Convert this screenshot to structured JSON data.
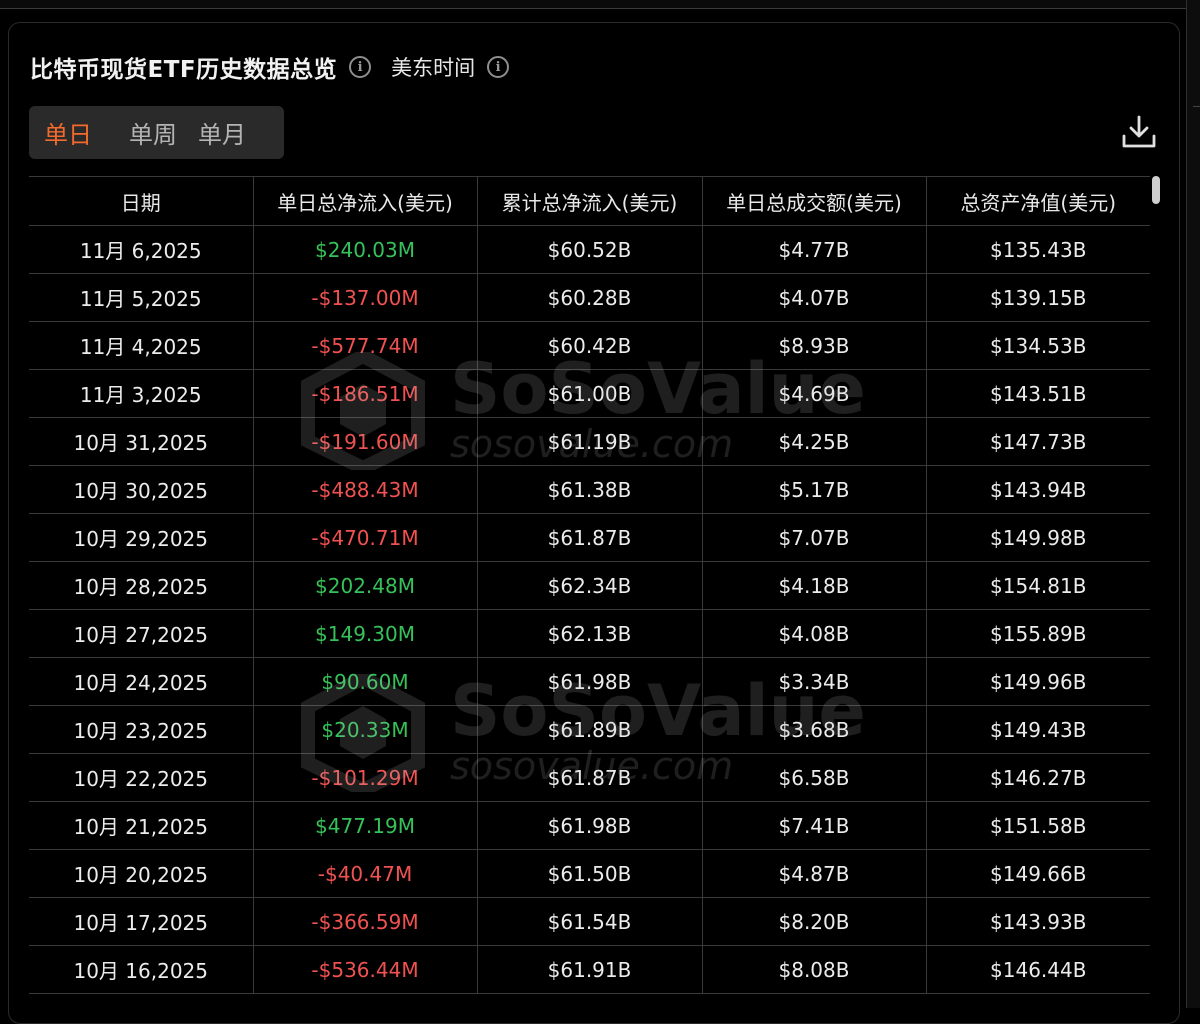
{
  "header": {
    "title": "比特币现货ETF历史数据总览",
    "timezone_label": "美东时间"
  },
  "tabs": [
    {
      "label": "单日",
      "active": true
    },
    {
      "label": "单周",
      "active": false
    },
    {
      "label": "单月",
      "active": false
    }
  ],
  "icons": {
    "title_info": "info-icon",
    "timezone_info": "info-icon",
    "download": "download-icon"
  },
  "colors": {
    "accent": "#f46a2c",
    "positive": "#36c25a",
    "negative": "#f05252"
  },
  "table": {
    "columns": [
      "日期",
      "单日总净流入(美元)",
      "累计总净流入(美元)",
      "单日总成交额(美元)",
      "总资产净值(美元)"
    ],
    "rows": [
      {
        "date": "11月 6,2025",
        "daily_net_inflow": "$240.03M",
        "cum_net_inflow": "$60.52B",
        "daily_volume": "$4.77B",
        "net_assets": "$135.43B",
        "sign": "pos"
      },
      {
        "date": "11月 5,2025",
        "daily_net_inflow": "-$137.00M",
        "cum_net_inflow": "$60.28B",
        "daily_volume": "$4.07B",
        "net_assets": "$139.15B",
        "sign": "neg"
      },
      {
        "date": "11月 4,2025",
        "daily_net_inflow": "-$577.74M",
        "cum_net_inflow": "$60.42B",
        "daily_volume": "$8.93B",
        "net_assets": "$134.53B",
        "sign": "neg"
      },
      {
        "date": "11月 3,2025",
        "daily_net_inflow": "-$186.51M",
        "cum_net_inflow": "$61.00B",
        "daily_volume": "$4.69B",
        "net_assets": "$143.51B",
        "sign": "neg"
      },
      {
        "date": "10月 31,2025",
        "daily_net_inflow": "-$191.60M",
        "cum_net_inflow": "$61.19B",
        "daily_volume": "$4.25B",
        "net_assets": "$147.73B",
        "sign": "neg"
      },
      {
        "date": "10月 30,2025",
        "daily_net_inflow": "-$488.43M",
        "cum_net_inflow": "$61.38B",
        "daily_volume": "$5.17B",
        "net_assets": "$143.94B",
        "sign": "neg"
      },
      {
        "date": "10月 29,2025",
        "daily_net_inflow": "-$470.71M",
        "cum_net_inflow": "$61.87B",
        "daily_volume": "$7.07B",
        "net_assets": "$149.98B",
        "sign": "neg"
      },
      {
        "date": "10月 28,2025",
        "daily_net_inflow": "$202.48M",
        "cum_net_inflow": "$62.34B",
        "daily_volume": "$4.18B",
        "net_assets": "$154.81B",
        "sign": "pos"
      },
      {
        "date": "10月 27,2025",
        "daily_net_inflow": "$149.30M",
        "cum_net_inflow": "$62.13B",
        "daily_volume": "$4.08B",
        "net_assets": "$155.89B",
        "sign": "pos"
      },
      {
        "date": "10月 24,2025",
        "daily_net_inflow": "$90.60M",
        "cum_net_inflow": "$61.98B",
        "daily_volume": "$3.34B",
        "net_assets": "$149.96B",
        "sign": "pos"
      },
      {
        "date": "10月 23,2025",
        "daily_net_inflow": "$20.33M",
        "cum_net_inflow": "$61.89B",
        "daily_volume": "$3.68B",
        "net_assets": "$149.43B",
        "sign": "pos"
      },
      {
        "date": "10月 22,2025",
        "daily_net_inflow": "-$101.29M",
        "cum_net_inflow": "$61.87B",
        "daily_volume": "$6.58B",
        "net_assets": "$146.27B",
        "sign": "neg"
      },
      {
        "date": "10月 21,2025",
        "daily_net_inflow": "$477.19M",
        "cum_net_inflow": "$61.98B",
        "daily_volume": "$7.41B",
        "net_assets": "$151.58B",
        "sign": "pos"
      },
      {
        "date": "10月 20,2025",
        "daily_net_inflow": "-$40.47M",
        "cum_net_inflow": "$61.50B",
        "daily_volume": "$4.87B",
        "net_assets": "$149.66B",
        "sign": "neg"
      },
      {
        "date": "10月 17,2025",
        "daily_net_inflow": "-$366.59M",
        "cum_net_inflow": "$61.54B",
        "daily_volume": "$8.20B",
        "net_assets": "$143.93B",
        "sign": "neg"
      },
      {
        "date": "10月 16,2025",
        "daily_net_inflow": "-$536.44M",
        "cum_net_inflow": "$61.91B",
        "daily_volume": "$8.08B",
        "net_assets": "$146.44B",
        "sign": "neg"
      }
    ]
  },
  "watermark": {
    "name": "SoSoValue",
    "url": "sosovalue.com"
  }
}
